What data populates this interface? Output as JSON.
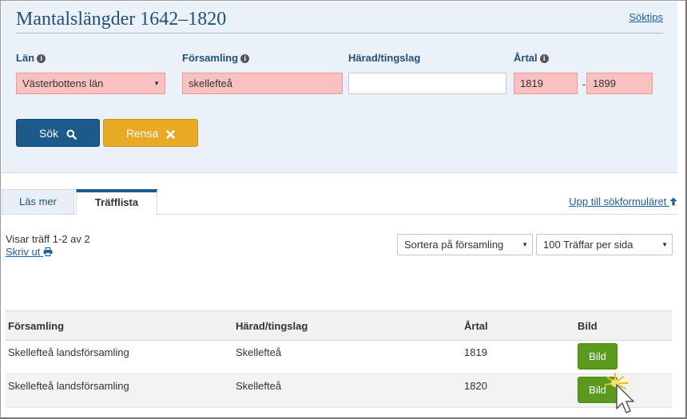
{
  "header": {
    "title": "Mantalslängder 1642–1820",
    "tips_link": "Söktips"
  },
  "form": {
    "lan": {
      "label": "Län",
      "value": "Västerbottens län"
    },
    "forsamling": {
      "label": "Församling",
      "value": "skellefteå"
    },
    "harad": {
      "label": "Härad/tingslag",
      "value": ""
    },
    "artal": {
      "label": "Årtal",
      "from": "1819",
      "dash": "-",
      "to": "1899"
    },
    "search_button": "Sök",
    "clear_button": "Rensa"
  },
  "tabs": [
    {
      "label": "Läs mer",
      "active": false
    },
    {
      "label": "Träfflista",
      "active": true
    }
  ],
  "back_link": "Upp till sökformuläret",
  "results": {
    "hit_info": "Visar träff 1-2 av 2",
    "print_link": "Skriv ut",
    "sort": "Sortera på församling",
    "per_page": "100 Träffar per sida",
    "columns": [
      "Församling",
      "Härad/tingslag",
      "Årtal",
      "Bild"
    ],
    "rows": [
      {
        "forsamling": "Skellefteå landsförsamling",
        "harad": "Skellefteå",
        "artal": "1819",
        "bild": "Bild"
      },
      {
        "forsamling": "Skellefteå landsförsamling",
        "harad": "Skellefteå",
        "artal": "1820",
        "bild": "Bild"
      }
    ]
  },
  "colors": {
    "primary": "#1d5a8c",
    "warning": "#e8a924",
    "success": "#5a9a1c",
    "error_field": "#fbc0c0",
    "panel": "#eaf1f8"
  }
}
